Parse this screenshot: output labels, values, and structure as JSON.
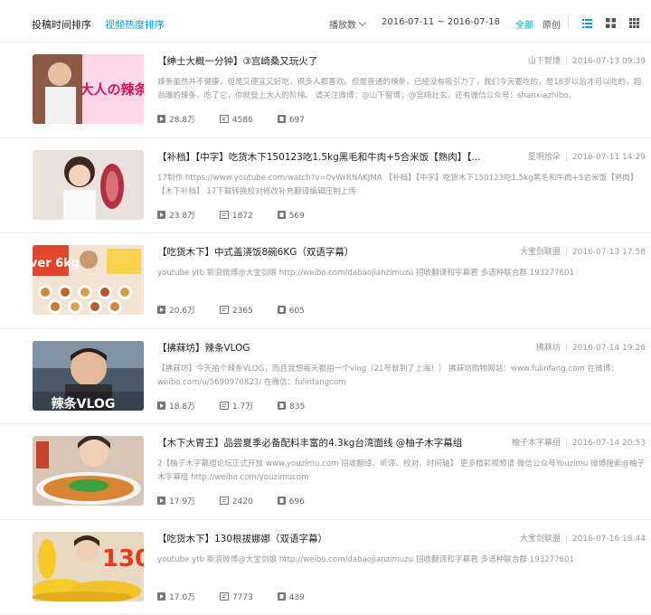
{
  "tabs": {
    "by_time": "投稿时间排序",
    "by_hot": "视频热度排序"
  },
  "filters": {
    "sort_label": "播放数",
    "date_range": "2016-07-11 ~ 2016-07-18",
    "all": "全部",
    "original": "原创"
  },
  "view_icons": [
    "list-view-icon",
    "grid-view-icon",
    "small-grid-view-icon"
  ],
  "colors": {
    "accent": "#00a1d6",
    "muted": "#999999",
    "divider": "#ebebeb"
  },
  "videos": [
    {
      "title": "【绅士大概一分钟】③宫崎桑又玩火了",
      "author": "山下智博",
      "date": "2016-07-13 09:39",
      "description": "辣条虽然并不健康，但是又便宜又好吃，很多人都喜欢。但是普通的辣条，已经没有吸引力了，我们今天要吃的，是18岁以后才可以吃的，超劲爆的辣条，吃了它，你就登上大人的阶梯。 请关注微博：@山下智博；@宫崎壮玄，还有微信公众号：shanxiazhibo。",
      "plays": "28.8万",
      "danmaku": "4586",
      "favorites": "697",
      "thumb_text": "大人の辣条"
    },
    {
      "title": "【补档】【中字】吃货木下150123吃1.5kg黑毛和牛肉+5合米饭【熟肉】【...",
      "author": "夏明拾朵",
      "date": "2016-07-11 14:29",
      "description": "17制作 https://www.youtube.com/watch?v=0vWrRNAKJMA 【补档】【中字】吃货木下150123吃1.5kg黑毛和牛肉+5合米饭【熟肉】【木下补档】 17下载转换校对修改补充翻译编辑压制上传",
      "plays": "23.8万",
      "danmaku": "1872",
      "favorites": "569",
      "thumb_text": ""
    },
    {
      "title": "【吃货木下】中式盖浇饭8碗6KG（双语字幕）",
      "author": "大宝剑联盟",
      "date": "2016-07-13 17:58",
      "description": "youtube ytb 新浪微博@大宝剑娘 http://weibo.com/dabaojianzimuzu 招收翻译和字幕君 多语种联合群 193277601",
      "plays": "20.6万",
      "danmaku": "2365",
      "favorites": "605",
      "thumb_text": "over 6kg"
    },
    {
      "title": "【拂菻坊】辣条VLOG",
      "author": "拂菻坊",
      "date": "2016-07-14 19:26",
      "description": "【拂菻坊】今天拍个辣条VLOG，而且我想每天都拍一个vlog（21号就到了上海！） 拂菻坊购物网站：www.fulinfang.com 在微博：weibo.com/u/5690970823/ 在微信：fulinfangcom",
      "plays": "18.8万",
      "danmaku": "1.7万",
      "favorites": "835",
      "thumb_text": "辣条VLOG"
    },
    {
      "title": "【木下大胃王】品尝夏季必备配料丰富的4.3kg台湾面线 @柚子木字幕组",
      "author": "柚子木字幕组",
      "date": "2016-07-14 20:53",
      "description": "2【柚子木字幕组论坛正式开放 www.youzimu.com 招收翻译、听译、校对、时间轴】 更多精彩视频请 微信公众号Youzimu 微博搜索@柚子木字幕组 http://weibo.com/youzimucom",
      "plays": "17.9万",
      "danmaku": "2420",
      "favorites": "696",
      "thumb_text": ""
    },
    {
      "title": "【吃货木下】130根拔娜娜（双语字幕）",
      "author": "大宝剑联盟",
      "date": "2016-07-16 18:44",
      "description": "youtube ytb 新浪微博@大宝剑娘 http://weibo.com/dabaojianzimuzu 招收翻译和字幕君 多语种联合群 193277601",
      "plays": "17.0万",
      "danmaku": "7773",
      "favorites": "439",
      "thumb_text": "130"
    }
  ]
}
